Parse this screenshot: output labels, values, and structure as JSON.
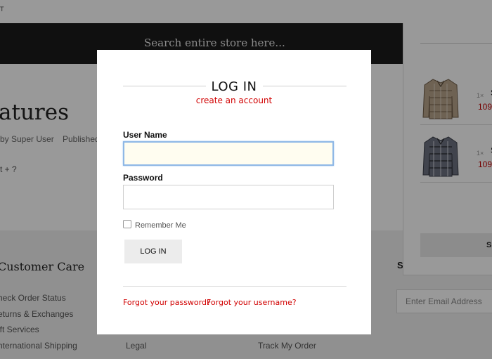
{
  "background": {
    "top_fragment": "T",
    "search_placeholder": "Search entire store here...",
    "page_title_fragment": "atures",
    "byline_author": "by Super User",
    "byline_published": "Published",
    "content_fragment": "t + ?",
    "footer": {
      "col1_heading": "Customer Care",
      "col1_links": [
        "heck Order Status",
        "eturns & Exchanges",
        "ift Services",
        "nternational Shipping"
      ],
      "col2_link": "Legal",
      "col3_link": "Track My Order",
      "col4_heading": "S",
      "email_placeholder": "Enter Email Address"
    }
  },
  "cart": {
    "items": [
      {
        "qty": "1×",
        "name": "S",
        "price": "109,"
      },
      {
        "qty": "1×",
        "name": "S",
        "price": "109,"
      }
    ],
    "button_label": "SI"
  },
  "modal": {
    "title": "LOG IN",
    "create_account": "create an account",
    "username_label": "User Name",
    "username_value": "",
    "password_label": "Password",
    "password_value": "",
    "remember_label": "Remember Me",
    "login_button": "LOG IN",
    "forgot_password": "Forgot your password?",
    "forgot_username": "Forgot your username?"
  },
  "colors": {
    "accent_red": "#d10000",
    "search_bar": "#1c1c1c",
    "focus_border": "#8fb8e6"
  }
}
